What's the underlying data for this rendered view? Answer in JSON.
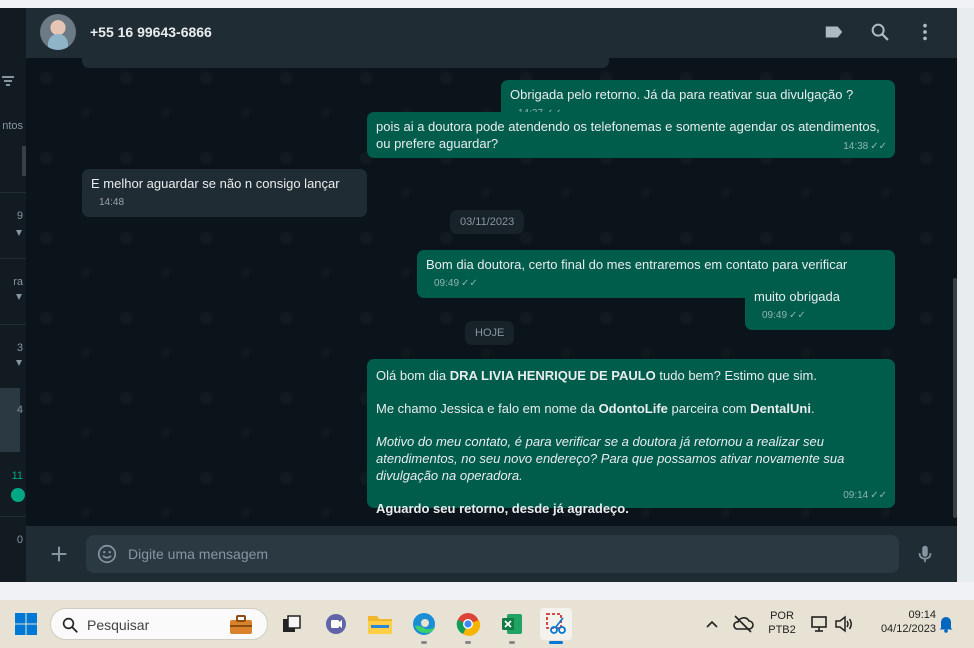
{
  "header": {
    "contact_name": "+55 16 99643-6866"
  },
  "left_pane": {
    "truncated_labels": [
      "ntos",
      "9",
      "ra",
      "3",
      "4",
      "11",
      "0"
    ]
  },
  "messages": [
    {
      "direction": "out",
      "text": "Obrigada pelo retorno. Já da para reativar sua divulgação ?",
      "time": "14:37"
    },
    {
      "direction": "out",
      "text": "pois ai a doutora pode atendendo os telefonemas e somente agendar os atendimentos, ou prefere aguardar?",
      "time": "14:38"
    },
    {
      "direction": "in",
      "text": "E melhor aguardar se não n consigo lançar",
      "time": "14:48"
    },
    {
      "direction": "out",
      "text": "Bom dia doutora, certo final do mes entraremos em contato para verificar",
      "time": "09:49"
    },
    {
      "direction": "out",
      "text": "muito obrigada",
      "time": "09:49"
    }
  ],
  "date_separators": [
    "03/11/2023",
    "HOJE"
  ],
  "last_message": {
    "line1_pre": "Olá bom dia ",
    "line1_bold": "DRA LIVIA HENRIQUE DE PAULO",
    "line1_post": " tudo bem? Estimo que sim.",
    "line2_pre": "Me chamo Jessica e falo em nome da ",
    "line2_bold1": "OdontoLife",
    "line2_mid": " parceira com ",
    "line2_bold2": "DentalUni",
    "line2_post": ".",
    "line3_italic": "Motivo do meu contato, é para verificar se a doutora já retornou a realizar seu atendimentos, no seu novo endereço? Para que possamos ativar novamente sua divulgação na operadora.",
    "line4_bold": "Aguardo seu retorno, desde já agradeço.",
    "time": "09:14"
  },
  "composer": {
    "placeholder": "Digite uma mensagem"
  },
  "taskbar": {
    "search_placeholder": "Pesquisar",
    "language_line1": "POR",
    "language_line2": "PTB2",
    "time": "09:14",
    "date": "04/12/2023"
  },
  "colors": {
    "outgoing_bubble": "#005c4b",
    "incoming_bubble": "#202c33",
    "background": "#0b141a",
    "accent": "#00a884"
  },
  "icons": {
    "header": [
      "label-icon",
      "search-icon",
      "menu-dots-icon"
    ],
    "composer": [
      "plus-icon",
      "emoji-icon",
      "microphone-icon"
    ]
  }
}
